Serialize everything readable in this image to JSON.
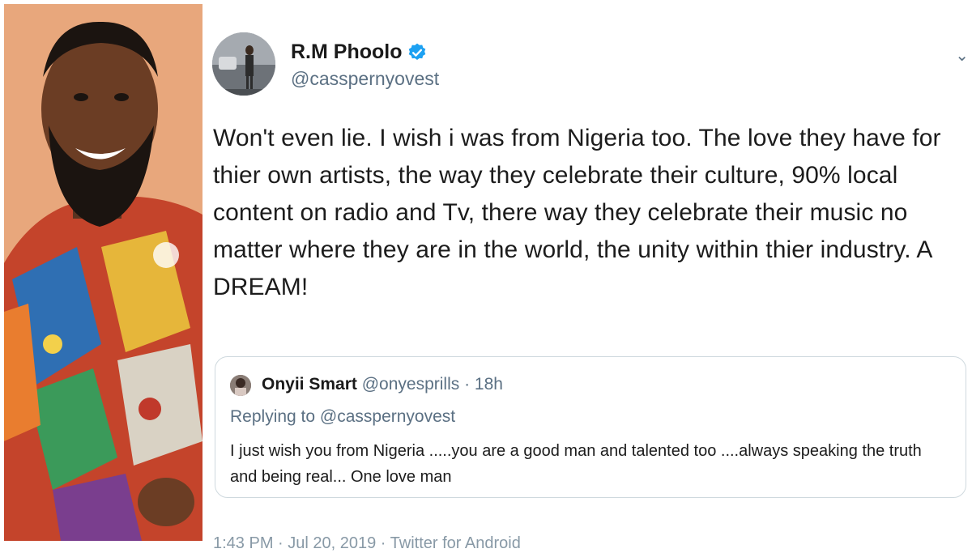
{
  "tweet": {
    "display_name": "R.M Phoolo",
    "handle": "@casspernyovest",
    "verified": true,
    "text": "Won't even lie. I wish i was from Nigeria too. The love they have for thier own artists, the way they celebrate their culture, 90% local content on radio and Tv,  there way they celebrate their music no matter where they are in the world, the unity within thier industry. A DREAM!",
    "footer": "1:43 PM · Jul 20, 2019 · Twitter for Android"
  },
  "quoted_tweet": {
    "display_name": "Onyii Smart",
    "handle": "@onyesprills",
    "separator": " · ",
    "time_ago": "18h",
    "replying_to": "Replying to @casspernyovest",
    "text": "I just wish you from Nigeria .....you are a good man and talented too ....always speaking the truth and being real... One love man"
  },
  "colors": {
    "verified_badge": "#1da1f2",
    "secondary_text": "#5b7083",
    "photo_background": "#e8a77c"
  }
}
